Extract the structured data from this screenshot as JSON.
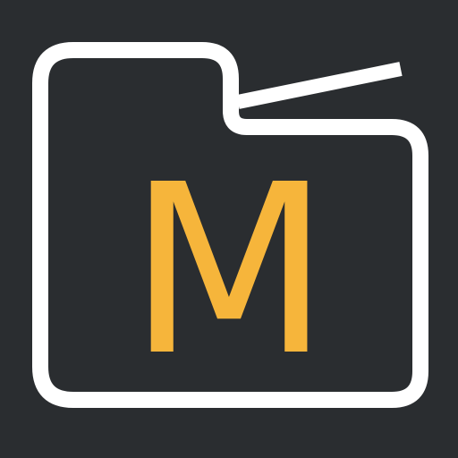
{
  "app_icon": {
    "letter": "M",
    "colors": {
      "background": "#2a2d30",
      "outline": "#ffffff",
      "letter": "#f6b53b"
    },
    "icon_name": "folder-outline-icon"
  }
}
